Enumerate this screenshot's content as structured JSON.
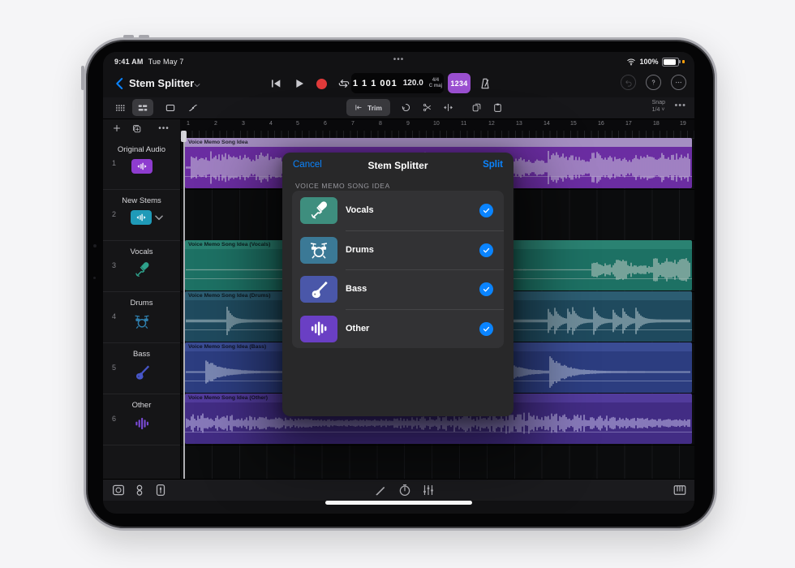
{
  "colors": {
    "accent": "#0a84ff",
    "record": "#e03a3a",
    "count_btn": "#9a4fd0",
    "battery_dot": "#ff9f0a"
  },
  "status": {
    "time": "9:41 AM",
    "date": "Tue May 7",
    "battery_pct": "100%"
  },
  "nav": {
    "title": "Stem Splitter"
  },
  "lcd": {
    "position": "1 1 1 001",
    "tempo": "120.0",
    "time_sig": "4/4",
    "key": "C maj"
  },
  "transport": {
    "count_in_label": "1234"
  },
  "toolbar": {
    "trim_label": "Trim",
    "snap_label": "Snap",
    "snap_value": "1/4",
    "more": "•••"
  },
  "ruler": {
    "bars": [
      "1",
      "2",
      "3",
      "4",
      "5",
      "6",
      "7",
      "8",
      "9",
      "10",
      "11",
      "12",
      "13",
      "14",
      "15",
      "16",
      "17",
      "18",
      "19"
    ]
  },
  "tracks": [
    {
      "num": "1",
      "name": "Original Audio",
      "icon": "waveform-region",
      "icon_color": "#8e3ccf"
    },
    {
      "num": "2",
      "name": "New Stems",
      "icon": "waveform-region",
      "icon_color": "#1f9ab8"
    },
    {
      "num": "3",
      "name": "Vocals",
      "icon": "microphone",
      "icon_color": "#2ea18b"
    },
    {
      "num": "4",
      "name": "Drums",
      "icon": "drum-kit",
      "icon_color": "#2f7fae"
    },
    {
      "num": "5",
      "name": "Bass",
      "icon": "bass-guitar",
      "icon_color": "#4756c8"
    },
    {
      "num": "6",
      "name": "Other",
      "icon": "waveform-bars",
      "icon_color": "#7a4bd6"
    }
  ],
  "regions": [
    {
      "label": "Voice Memo Song Idea",
      "type": "voice",
      "body": "#6b2da2",
      "strip": "#a58fc2",
      "wave": "#b6a4cf"
    },
    {
      "label": "Voice Memo Song Idea (Vocals)",
      "type": "vocals",
      "body": "#1d7164",
      "strip": "#2a8272",
      "wave": "#9cb8b0"
    },
    {
      "label": "Voice Memo Song Idea (Drums)",
      "type": "drums",
      "body": "#1f4a5e",
      "strip": "#2c5d72",
      "wave": "#93abb5"
    },
    {
      "label": "Voice Memo Song Idea (Bass)",
      "type": "bass",
      "body": "#2c3d80",
      "strip": "#3a4c94",
      "wave": "#9ba6c8"
    },
    {
      "label": "Voice Memo Song Idea (Other)",
      "type": "other",
      "body": "#422c84",
      "strip": "#523b9c",
      "wave": "#a59bd1"
    }
  ],
  "dialog": {
    "cancel": "Cancel",
    "title": "Stem Splitter",
    "split": "Split",
    "section": "VOICE MEMO SONG IDEA",
    "stems": [
      {
        "label": "Vocals",
        "icon": "microphone",
        "tile": "#3e8e7e",
        "checked": true
      },
      {
        "label": "Drums",
        "icon": "drum-kit",
        "tile": "#3b7996",
        "checked": true
      },
      {
        "label": "Bass",
        "icon": "bass-guitar",
        "tile": "#4a57a9",
        "checked": true
      },
      {
        "label": "Other",
        "icon": "waveform-bars",
        "tile": "#6a3fc4",
        "checked": true
      }
    ]
  }
}
